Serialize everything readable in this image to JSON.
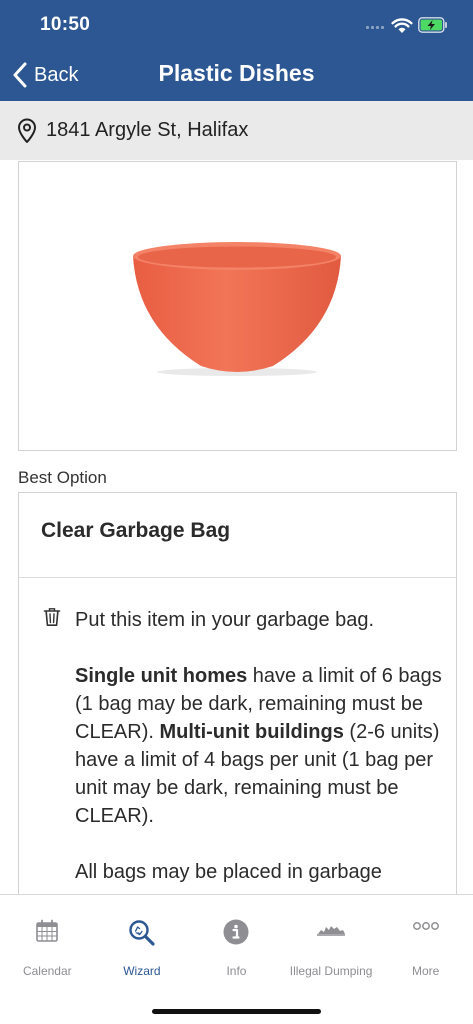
{
  "status_bar": {
    "time": "10:50"
  },
  "nav": {
    "back_label": "Back",
    "title": "Plastic Dishes"
  },
  "address": {
    "text": "1841 Argyle St, Halifax"
  },
  "best_option_label": "Best Option",
  "card": {
    "title": "Clear Garbage Bag",
    "line1": "Put this item in your garbage bag.",
    "single_bold": "Single unit homes",
    "single_text": " have a limit of 6 bags (1 bag may be dark, remaining must be CLEAR). ",
    "multi_bold": "Multi-unit buildings",
    "multi_text": " (2-6 units) have a limit of 4 bags per unit (1 bag per unit may be dark, remaining must be CLEAR).",
    "line3": "All bags may be placed in garbage"
  },
  "tabs": [
    {
      "label": "Calendar",
      "icon": "calendar-icon",
      "active": false
    },
    {
      "label": "Wizard",
      "icon": "wizard-search-icon",
      "active": true
    },
    {
      "label": "Info",
      "icon": "info-icon",
      "active": false
    },
    {
      "label": "Illegal Dumping",
      "icon": "illegal-dumping-icon",
      "active": false
    },
    {
      "label": "More",
      "icon": "more-icon",
      "active": false
    }
  ],
  "colors": {
    "header": "#2c5792",
    "accent": "#2c5792",
    "bowl": "#f06a4f",
    "inactive": "#8e8e93"
  }
}
